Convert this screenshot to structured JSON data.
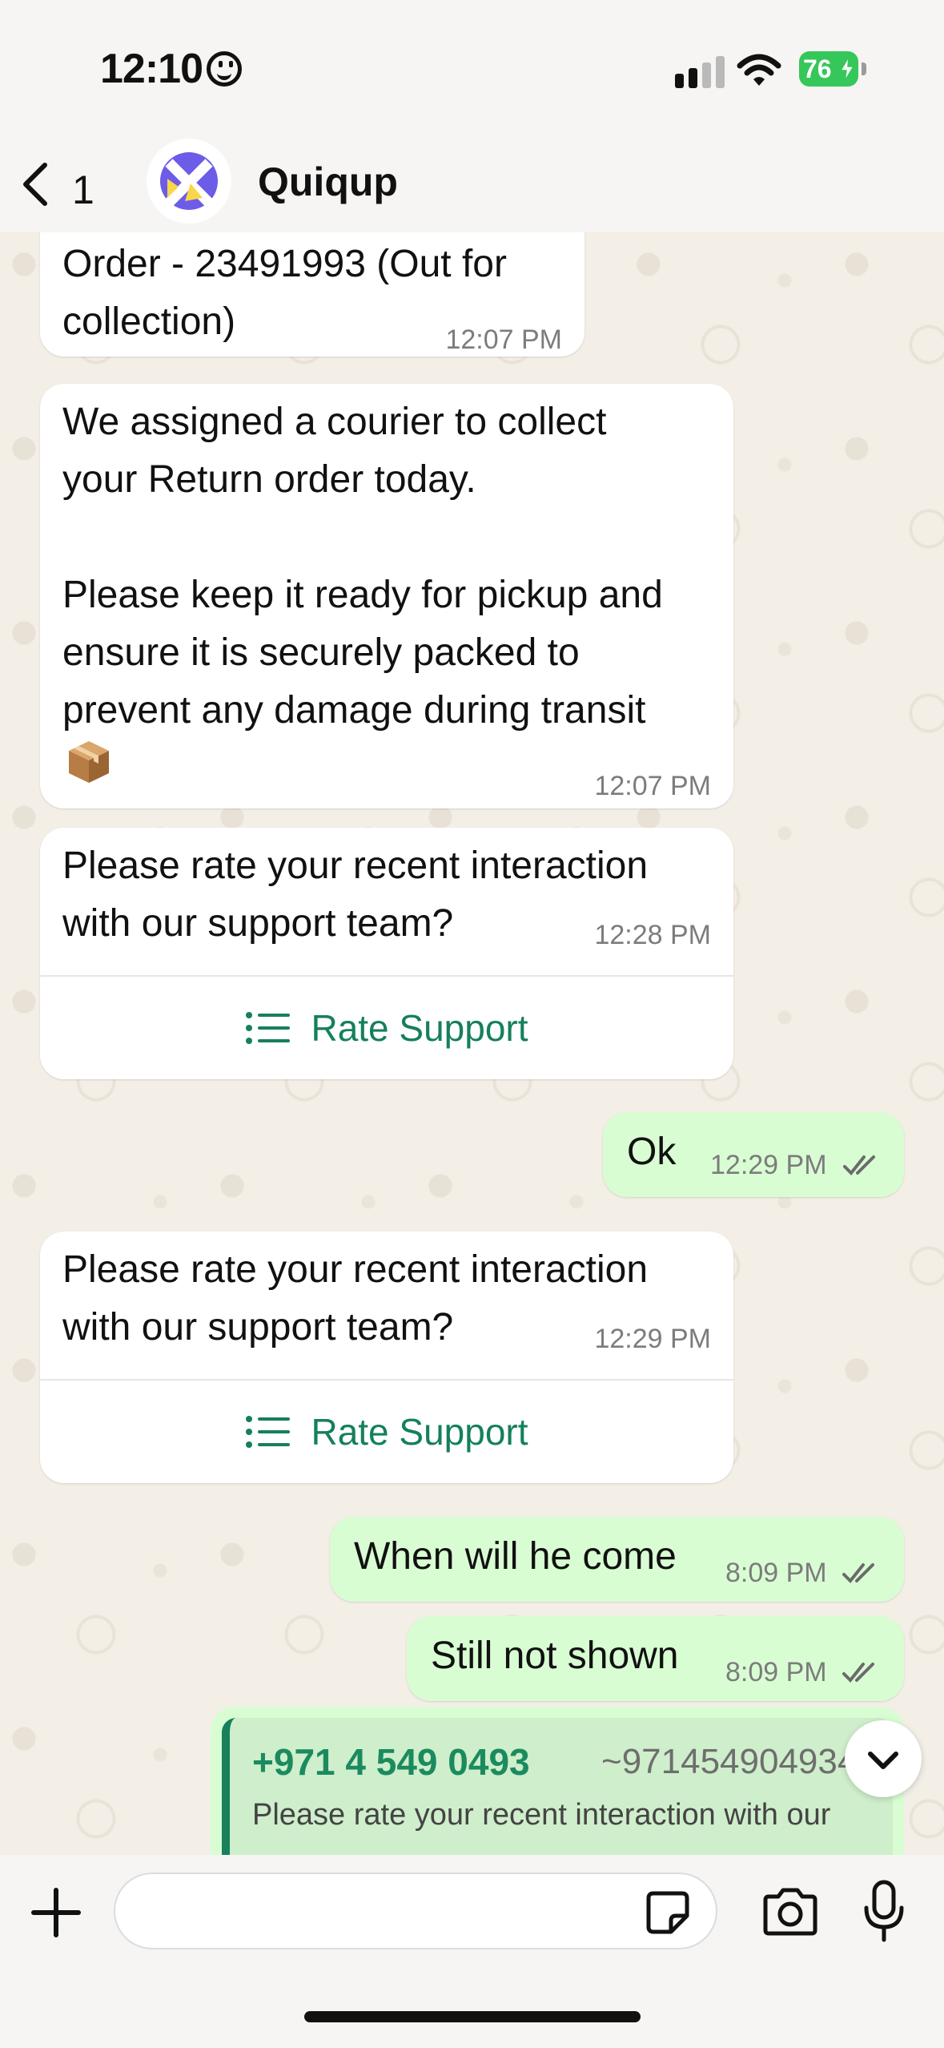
{
  "status_bar": {
    "time": "12:10",
    "battery": "76",
    "icons": [
      "emoji-face-icon",
      "signal-icon",
      "wifi-icon",
      "battery-charging-icon"
    ]
  },
  "header": {
    "back_count": "1",
    "contact_name": "Quiqup",
    "avatar_icon": "quiqup-logo-icon"
  },
  "messages": [
    {
      "direction": "incoming",
      "text": "Order - 23491993 (Out for\ncollection)",
      "time": "12:07 PM"
    },
    {
      "direction": "incoming",
      "text": "We assigned a courier to collect\nyour Return order today.\n\nPlease keep it ready for pickup and\nensure it is securely packed to\nprevent any damage during transit",
      "time": "12:07 PM",
      "emoji_icon": "package-icon"
    },
    {
      "direction": "incoming",
      "text": "Please rate your recent interaction\nwith our support team?",
      "time": "12:28 PM",
      "button_label": "Rate Support"
    },
    {
      "direction": "outgoing",
      "text": "Ok",
      "time": "12:29 PM",
      "status": "read"
    },
    {
      "direction": "incoming",
      "text": "Please rate your recent interaction\nwith our support team?",
      "time": "12:29 PM",
      "button_label": "Rate Support"
    },
    {
      "direction": "outgoing",
      "text": "When will he come",
      "time": "8:09 PM",
      "status": "read"
    },
    {
      "direction": "outgoing",
      "text": "Still not shown",
      "time": "8:09 PM",
      "status": "read"
    }
  ],
  "quoted_reply": {
    "phone": "+971 4 549 0493",
    "alias": "~971454904934",
    "text": "Please rate your recent interaction with our"
  },
  "input_bar": {
    "placeholder": "",
    "icons": [
      "plus-icon",
      "sticker-icon",
      "camera-icon",
      "microphone-icon"
    ]
  },
  "colors": {
    "outgoing_bubble": "#d9fdd3",
    "incoming_bubble": "#ffffff",
    "accent_green": "#15805b",
    "battery_green": "#35c759"
  }
}
